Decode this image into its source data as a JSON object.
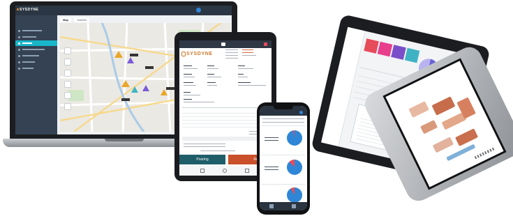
{
  "laptop": {
    "logo": "SYSDYNE",
    "user": "",
    "sidebar_items": [
      "",
      "",
      "",
      "",
      "",
      "",
      ""
    ],
    "active_sidebar_index": 2,
    "tabs": [
      "Map",
      "Satellite"
    ],
    "active_tab": "Map"
  },
  "tablet": {
    "logo": "SYSDYNE",
    "action_left": "Pouring",
    "action_right": "Returning"
  },
  "phone": {
    "cards": [
      "",
      "",
      ""
    ]
  },
  "colors": {
    "brand_orange": "#cc7a2d",
    "nav_dark": "#2b3644",
    "active_teal": "#19b6c9",
    "pour_teal": "#1f5e69",
    "return_red": "#c9502a",
    "donut_blue": "#2f86d6"
  }
}
